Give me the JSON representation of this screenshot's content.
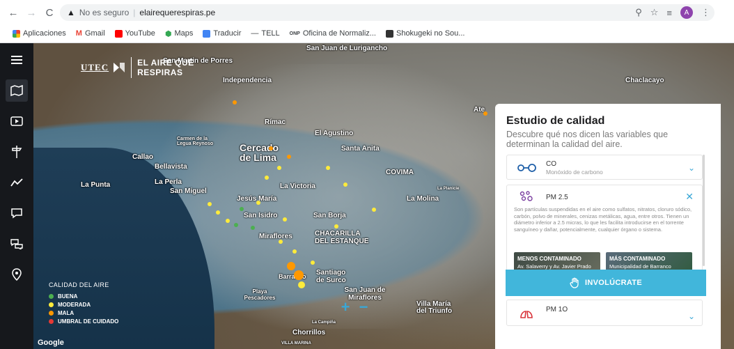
{
  "browser": {
    "security_text": "No es seguro",
    "url": "elairequerespiras.pe",
    "profile_initial": "A",
    "bookmarks": [
      "Aplicaciones",
      "Gmail",
      "YouTube",
      "Maps",
      "Traducir",
      "TELL",
      "Oficina de Normaliz...",
      "Shokugeki no Sou..."
    ]
  },
  "brand": {
    "utec": "UTEC",
    "title_line1": "EL AIRE QUE",
    "title_line2": "RESPIRAS"
  },
  "map": {
    "attribution": "Google",
    "labels": [
      "San Martin de Porres",
      "Independencia",
      "San Juan de Lurigancho",
      "Rímac",
      "El Agustino",
      "Chaclacayo",
      "Ate",
      "Callao",
      "Cercado de Lima",
      "Santa Anita",
      "Bellavista",
      "Carmen de la Legua Reynoso",
      "La Perla",
      "La Punta",
      "San Miguel",
      "La Victoria",
      "COVIMA",
      "La Molina",
      "La Planicie",
      "Jesús María",
      "San Isidro",
      "San Borja",
      "Miraflores",
      "CHACARILLA DEL ESTANQUE",
      "Santiago de Surco",
      "Barranco",
      "Playa Pescadores",
      "San Juan de Miraflores",
      "Villa María del Triunfo",
      "La Campiña",
      "Chorrillos",
      "VILLA MARINA"
    ],
    "legend_title": "CALIDAD DEL AIRE",
    "legend": [
      {
        "label": "BUENA",
        "color": "#4caf50"
      },
      {
        "label": "MODERADA",
        "color": "#ffeb3b"
      },
      {
        "label": "MALA",
        "color": "#ff9800"
      },
      {
        "label": "UMBRAL DE CUIDADO",
        "color": "#e53935"
      }
    ],
    "zoom_in": "+",
    "zoom_out": "−"
  },
  "panel": {
    "title": "Estudio de calidad",
    "subtitle": "Descubre qué nos dicen las variables que determinan la calidad del aire.",
    "co": {
      "name": "CO",
      "desc": "Monóxido de carbono"
    },
    "pm25": {
      "name": "PM 2.5",
      "desc": "Son partículas suspendidas en el aire como sulfatos, nitratos, cloruro sódico, carbón, polvo de minerales, cenizas metálicas, agua, entre otros. Tienen un diámetro inferior a 2.5 micras, lo que les facilita introducirse en el torrente sanguíneo y dañar, potencialmente, cualquier órgano o sistema.",
      "less_title": "MENOS CONTAMINADO",
      "less_place": "Av. Salaverry y Av. Javier Prado",
      "more_title": "MÁS CONTAMINADO",
      "more_place": "Municipalidad de Barranco"
    },
    "pm10": {
      "name": "PM 1O"
    },
    "cta": "INVOLÚCRATE"
  }
}
